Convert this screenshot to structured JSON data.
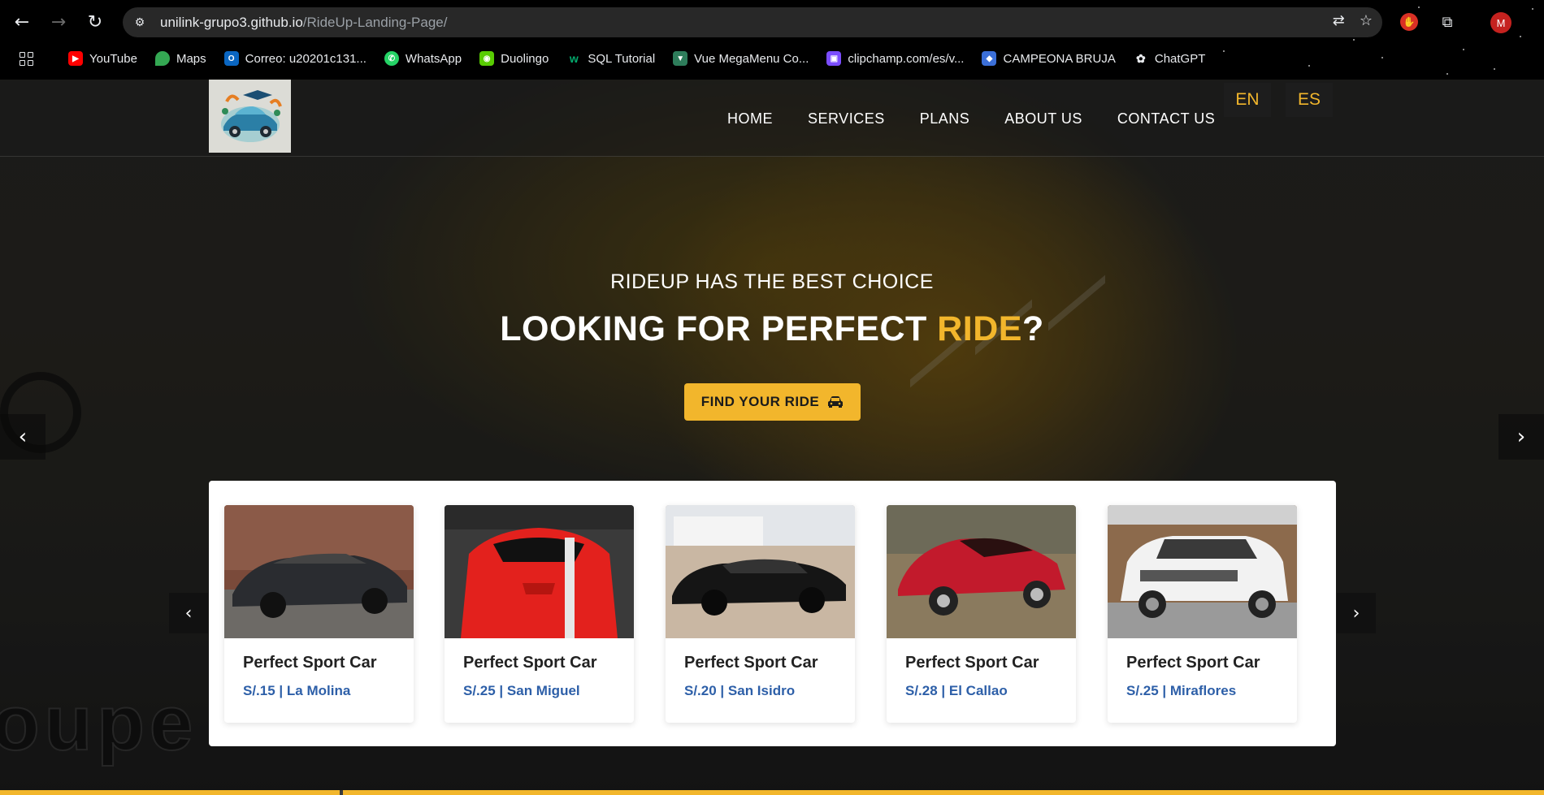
{
  "browser": {
    "url_host": "unilink-grupo3.github.io",
    "url_path": "/RideUp-Landing-Page/",
    "avatar_letter": "M",
    "bookmarks": [
      {
        "label": "YouTube",
        "color": "#ff0000",
        "icon": "youtube-icon"
      },
      {
        "label": "Maps",
        "color": "#34a853",
        "icon": "maps-icon"
      },
      {
        "label": "Correo: u20201c131...",
        "color": "#0a66c2",
        "icon": "outlook-icon"
      },
      {
        "label": "WhatsApp",
        "color": "#25d366",
        "icon": "whatsapp-icon"
      },
      {
        "label": "Duolingo",
        "color": "#58cc02",
        "icon": "duolingo-icon"
      },
      {
        "label": "SQL Tutorial",
        "color": "#04aa6d",
        "icon": "w3schools-icon"
      },
      {
        "label": "Vue MegaMenu Co...",
        "color": "#2e7d5b",
        "icon": "vue-icon"
      },
      {
        "label": "clipchamp.com/es/v...",
        "color": "#7b4dff",
        "icon": "clipchamp-icon"
      },
      {
        "label": "CAMPEONA BRUJA",
        "color": "#3b6fd8",
        "icon": "package-icon"
      },
      {
        "label": "ChatGPT",
        "color": "#5f6368",
        "icon": "chatgpt-icon"
      }
    ]
  },
  "nav": {
    "links": [
      "HOME",
      "SERVICES",
      "PLANS",
      "ABOUT US",
      "CONTACT US"
    ],
    "lang_en": "EN",
    "lang_es": "ES"
  },
  "hero": {
    "subtitle": "RIDEUP HAS THE BEST CHOICE",
    "title_start": "LOOKING FOR PERFECT ",
    "title_accent": "RIDE",
    "title_end": "?",
    "button_label": "FIND YOUR RIDE",
    "accent_color": "#f2b62c",
    "prev_glyph": "‹",
    "next_glyph": "›"
  },
  "cars": {
    "prev_glyph": "‹",
    "next_glyph": "›",
    "items": [
      {
        "name": "Perfect Sport Car",
        "info": "S/.15 | La Molina",
        "body_color": "#2a2c30"
      },
      {
        "name": "Perfect Sport Car",
        "info": "S/.25 | San Miguel",
        "body_color": "#e3211d"
      },
      {
        "name": "Perfect Sport Car",
        "info": "S/.20 | San Isidro",
        "body_color": "#151515"
      },
      {
        "name": "Perfect Sport Car",
        "info": "S/.28 | El Callao",
        "body_color": "#c21a2c"
      },
      {
        "name": "Perfect Sport Car",
        "info": "S/.25 | Miraflores",
        "body_color": "#f2f2f2"
      }
    ]
  },
  "background_watermark": "oupe"
}
